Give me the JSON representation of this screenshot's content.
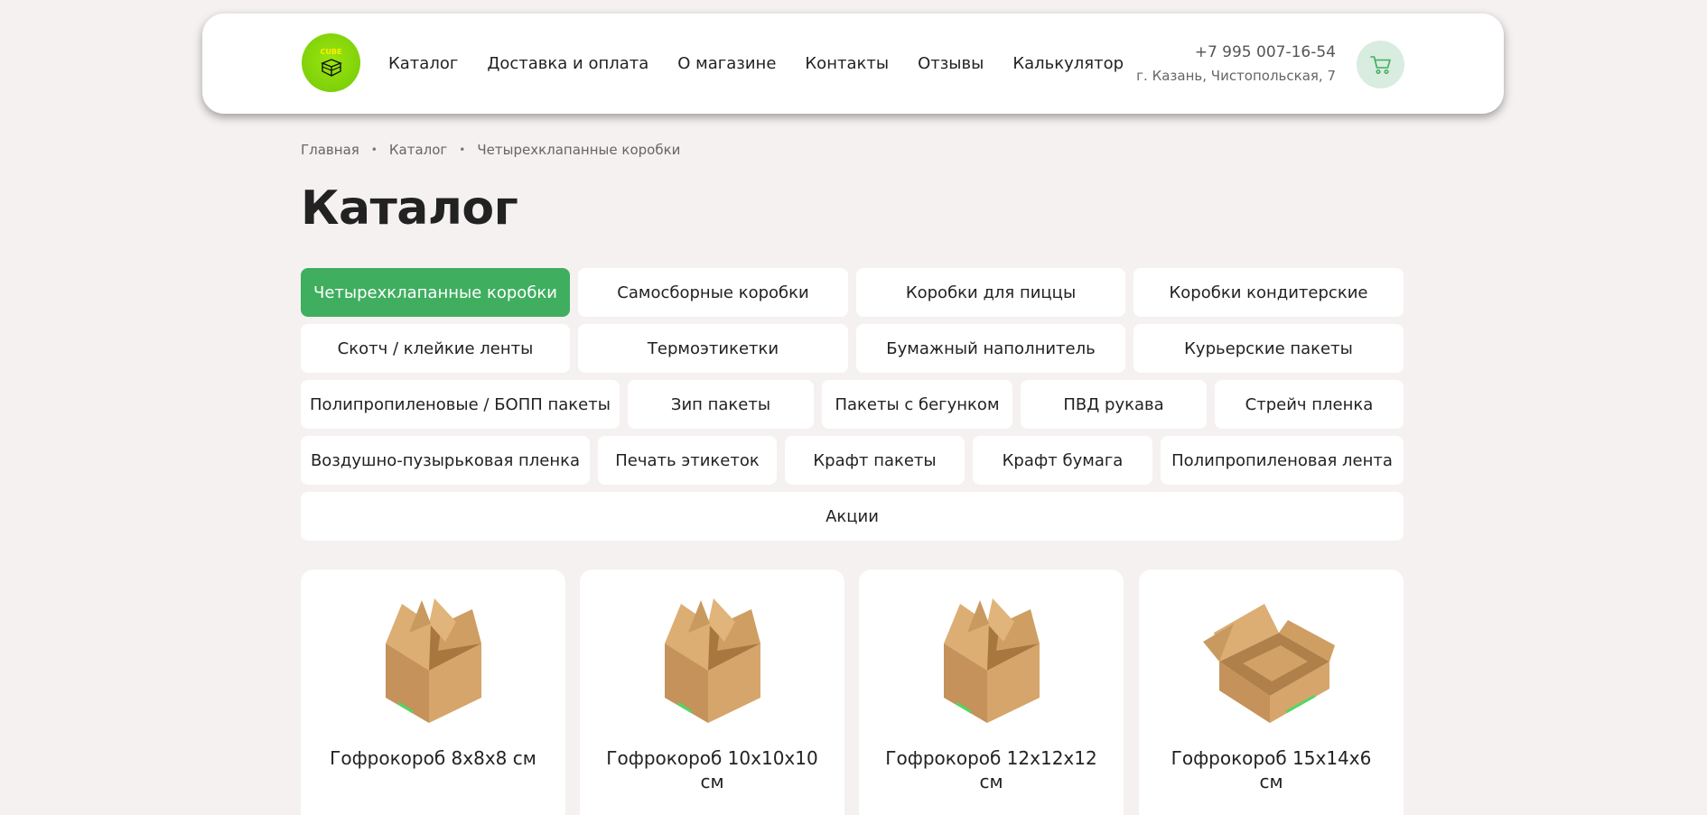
{
  "brand": {
    "logo_text": "CUBE",
    "accent": "#3fae5f",
    "logo_color": "#7fd10a"
  },
  "nav": {
    "items": [
      {
        "label": "Каталог"
      },
      {
        "label": "Доставка и оплата"
      },
      {
        "label": "О магазине"
      },
      {
        "label": "Контакты"
      },
      {
        "label": "Отзывы"
      },
      {
        "label": "Калькулятор"
      }
    ]
  },
  "contact": {
    "phone": "+7 995 007-16-54",
    "address": "г. Казань, Чистопольская, 7"
  },
  "cart": {
    "icon": "cart-icon"
  },
  "breadcrumb": [
    "Главная",
    "Каталог",
    "Четырехклапанные коробки"
  ],
  "page_title": "Каталог",
  "categories": {
    "rows": [
      [
        "Четырехклапанные коробки",
        "Самосборные коробки",
        "Коробки для пиццы",
        "Коробки кондитерские"
      ],
      [
        "Скотч / клейкие ленты",
        "Термоэтикетки",
        "Бумажный наполнитель",
        "Курьерские пакеты"
      ],
      [
        "Полипропиленовые / БОПП пакеты",
        "Зип пакеты",
        "Пакеты с бегунком",
        "ПВД рукава",
        "Стрейч пленка"
      ],
      [
        "Воздушно-пузырьковая пленка",
        "Печать этикеток",
        "Крафт пакеты",
        "Крафт бумага",
        "Полипропиленовая лента"
      ],
      [
        "Акции"
      ]
    ],
    "active": "Четырехклапанные коробки"
  },
  "products": [
    {
      "name": "Гофрокороб 8х8х8 см",
      "image": "cardboard-box-open-cube"
    },
    {
      "name": "Гофрокороб 10х10х10 см",
      "image": "cardboard-box-open-cube"
    },
    {
      "name": "Гофрокороб 12х12х12 см",
      "image": "cardboard-box-open-cube"
    },
    {
      "name": "Гофрокороб 15х14х6 см",
      "image": "cardboard-box-open-flat"
    }
  ]
}
